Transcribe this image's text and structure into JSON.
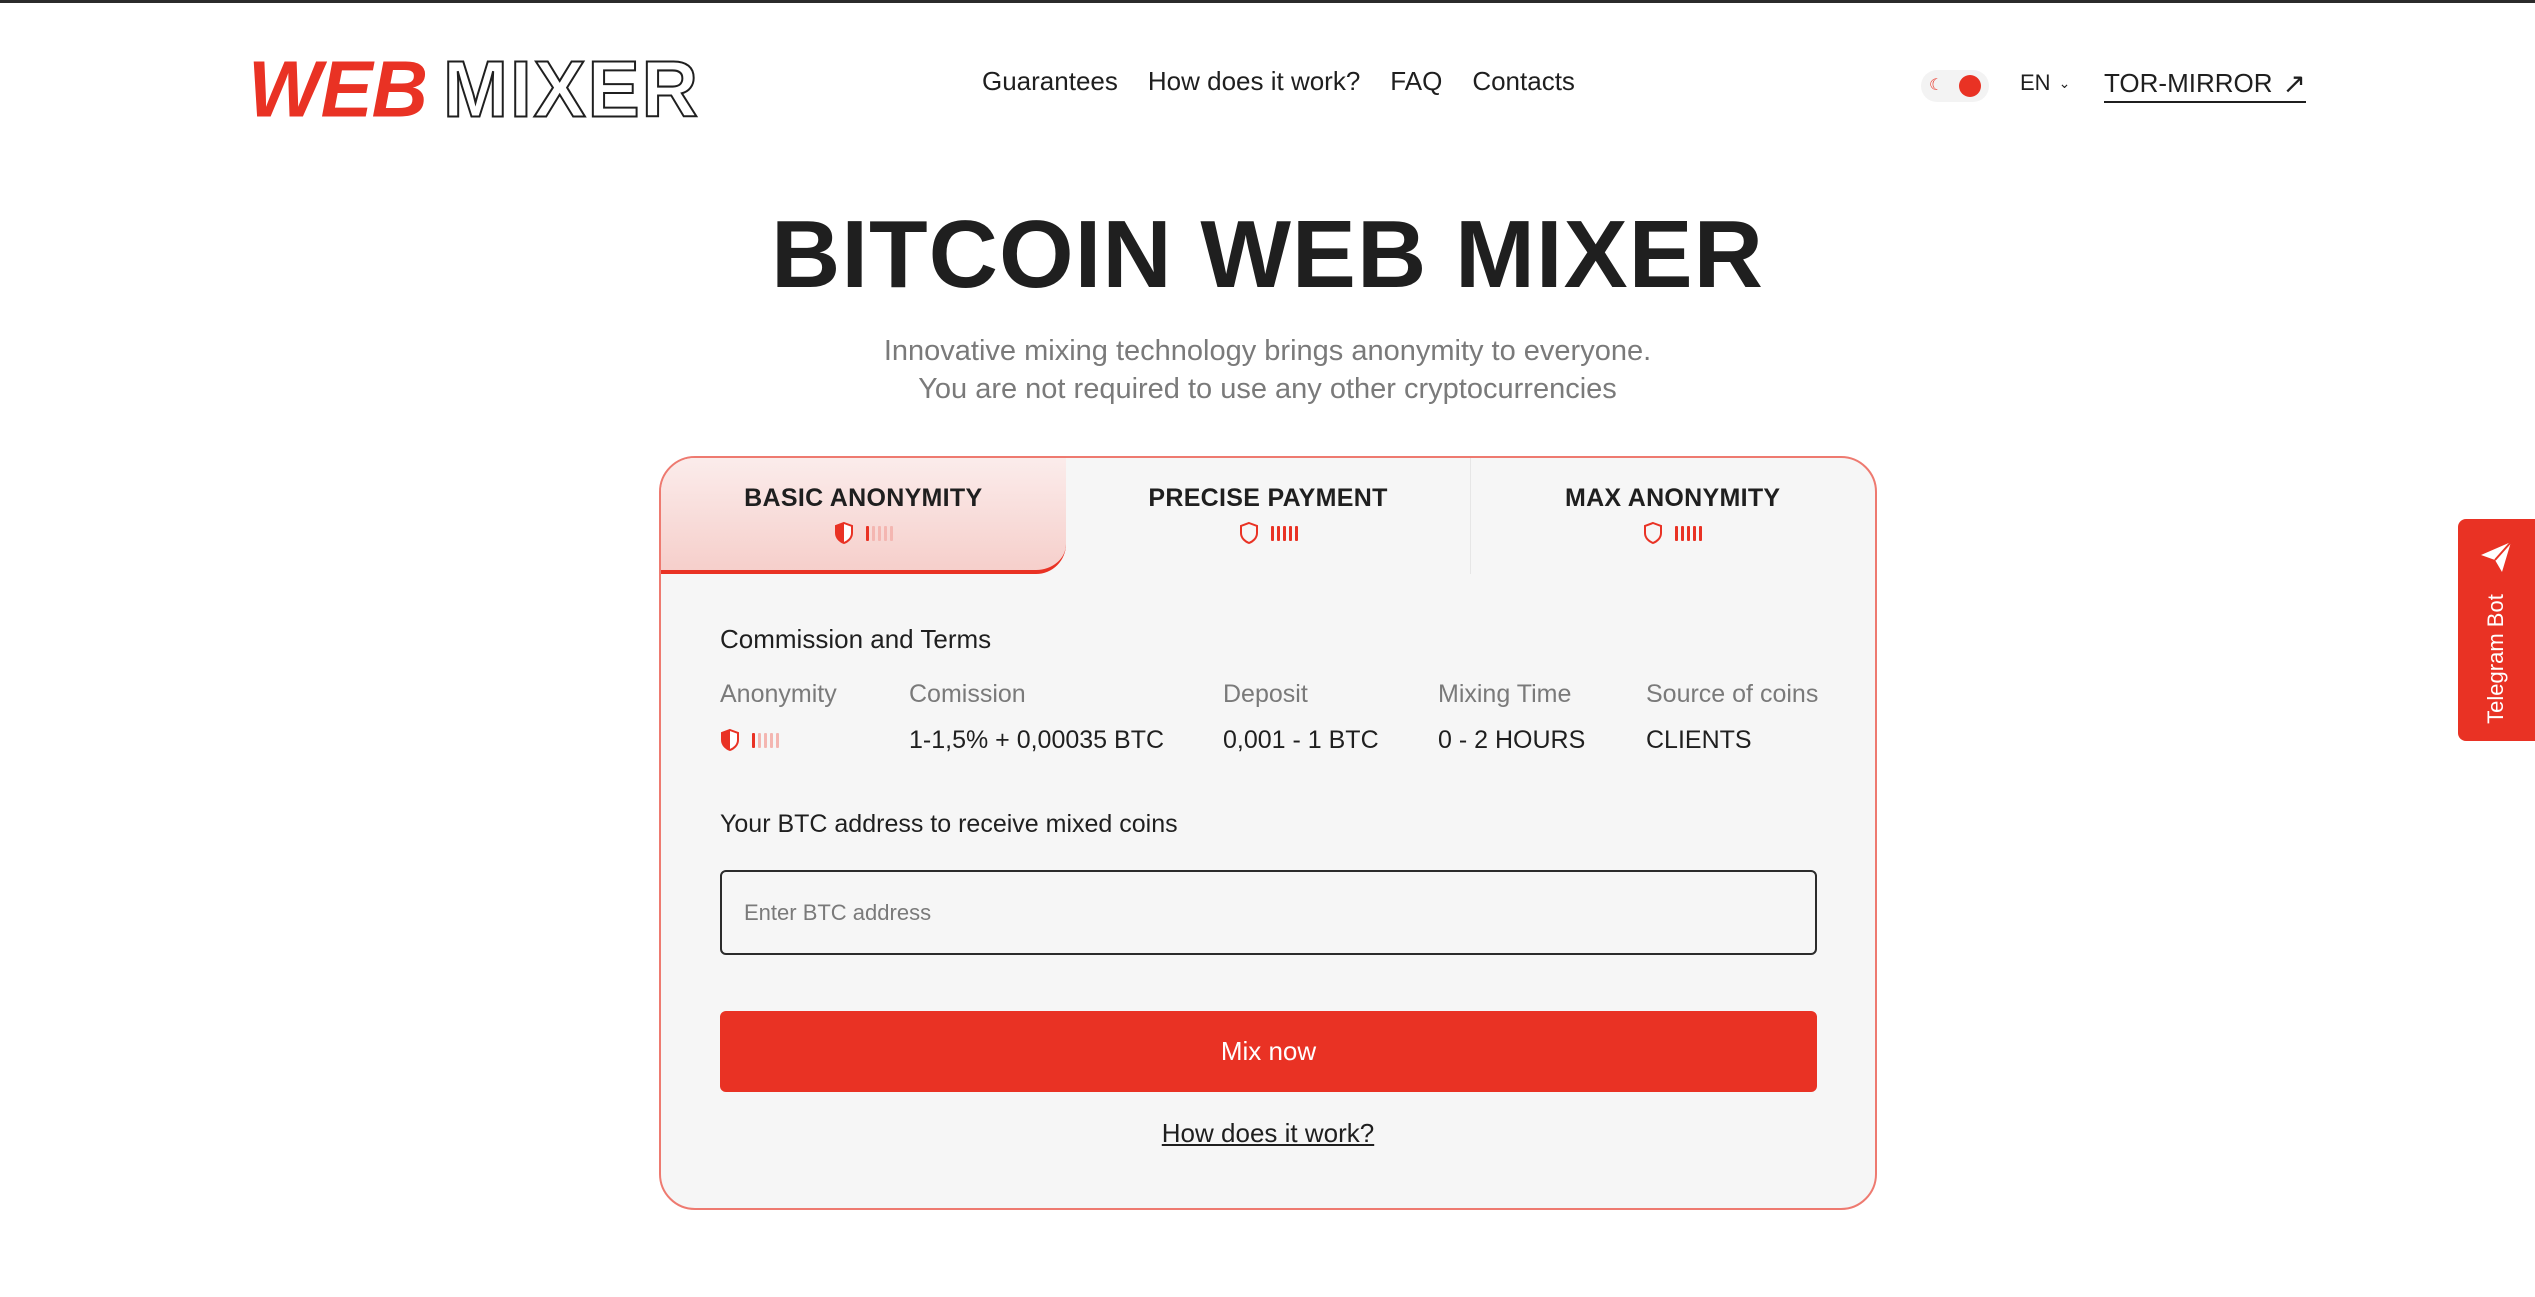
{
  "header": {
    "logo": {
      "part1": "WEB",
      "part2": "MIXER"
    },
    "nav": [
      "Guarantees",
      "How does it work?",
      "FAQ",
      "Contacts"
    ],
    "theme_toggle": {
      "icon": "moon-icon",
      "state": "light"
    },
    "language": "EN",
    "tor_mirror": "TOR-MIRROR"
  },
  "hero": {
    "title": "BITCOIN WEB MIXER",
    "subtitle_line1": "Innovative mixing technology brings anonymity to everyone.",
    "subtitle_line2": "You are not required to use any other cryptocurrencies"
  },
  "card": {
    "tabs": [
      {
        "label": "BASIC ANONYMITY",
        "active": true,
        "level": 1,
        "max_level": 5
      },
      {
        "label": "PRECISE PAYMENT",
        "active": false,
        "level": 5,
        "max_level": 5
      },
      {
        "label": "MAX ANONYMITY",
        "active": false,
        "level": 5,
        "max_level": 5
      }
    ],
    "section_title": "Commission and Terms",
    "terms": {
      "anonymity": {
        "label": "Anonymity",
        "level": 1,
        "max_level": 5
      },
      "commission": {
        "label": "Comission",
        "value": "1-1,5% + 0,00035 BTC"
      },
      "deposit": {
        "label": "Deposit",
        "value": "0,001 - 1 BTC"
      },
      "mixing_time": {
        "label": "Mixing Time",
        "value": "0 - 2 HOURS"
      },
      "source": {
        "label": "Source of coins",
        "value": "CLIENTS"
      }
    },
    "address_label": "Your BTC address to receive mixed coins",
    "address_placeholder": "Enter BTC address",
    "address_value": "",
    "mix_button": "Mix now",
    "how_link": "How does it work?"
  },
  "telegram": {
    "label": "Telegram Bot",
    "icon": "paper-plane-icon"
  },
  "colors": {
    "accent": "#e93224",
    "text": "#1f1f1f",
    "muted": "#7a7a7a",
    "card_bg": "#f6f6f6"
  }
}
